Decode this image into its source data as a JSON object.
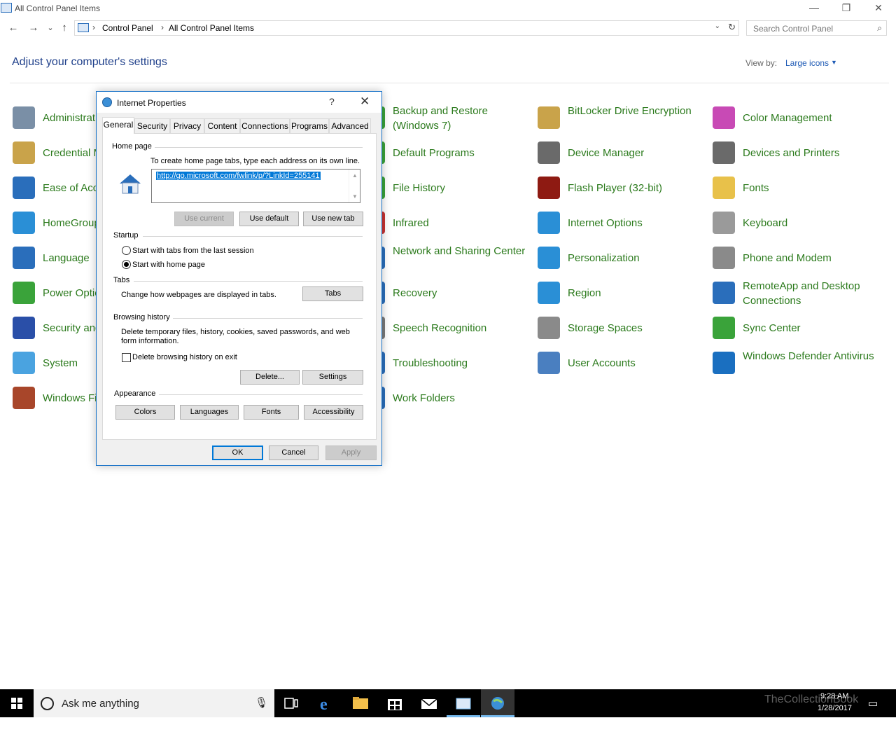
{
  "window": {
    "title": "All Control Panel Items",
    "controls": {
      "minimize": "—",
      "restore": "❐",
      "close": "✕"
    }
  },
  "nav": {
    "back": "←",
    "forward": "→",
    "recent": "⌄",
    "up": "↑",
    "breadcrumb": [
      "Control Panel",
      "All Control Panel Items"
    ],
    "search_placeholder": "Search Control Panel"
  },
  "header": {
    "title": "Adjust your computer's settings",
    "view_by_label": "View by:",
    "view_by_value": "Large icons"
  },
  "items": [
    {
      "label": "Administrative Tools",
      "icon": "admin-tools-icon",
      "color": "#7a8fa6"
    },
    {
      "label": "Credential Manager",
      "icon": "credential-icon",
      "color": "#c9a34a"
    },
    {
      "label": "Ease of Access Center",
      "icon": "ease-of-access-icon",
      "color": "#2a6ebb"
    },
    {
      "label": "HomeGroup",
      "icon": "homegroup-icon",
      "color": "#2a8fd6"
    },
    {
      "label": "Language",
      "icon": "language-icon",
      "color": "#2a6ebb"
    },
    {
      "label": "Power Options",
      "icon": "power-icon",
      "color": "#3aa33a"
    },
    {
      "label": "Security and Maintenance",
      "icon": "security-flag-icon",
      "color": "#2a4fa8"
    },
    {
      "label": "System",
      "icon": "system-icon",
      "color": "#4aa3e0"
    },
    {
      "label": "Windows Firewall",
      "icon": "firewall-icon",
      "color": "#a8462a"
    },
    {
      "label": "Backup and Restore (Windows 7)",
      "icon": "backup-icon",
      "color": "#3aa33a"
    },
    {
      "label": "Default Programs",
      "icon": "default-programs-icon",
      "color": "#3aa33a"
    },
    {
      "label": "File History",
      "icon": "file-history-icon",
      "color": "#3aa33a"
    },
    {
      "label": "Infrared",
      "icon": "infrared-icon",
      "color": "#c83232"
    },
    {
      "label": "Network and Sharing Center",
      "icon": "network-icon",
      "color": "#2a6ebb"
    },
    {
      "label": "Recovery",
      "icon": "recovery-icon",
      "color": "#2a6ebb"
    },
    {
      "label": "Speech Recognition",
      "icon": "speech-icon",
      "color": "#7a7a7a"
    },
    {
      "label": "Troubleshooting",
      "icon": "troubleshooting-icon",
      "color": "#2a6ebb"
    },
    {
      "label": "Work Folders",
      "icon": "work-folders-icon",
      "color": "#2a6ebb"
    },
    {
      "label": "BitLocker Drive Encryption",
      "icon": "bitlocker-icon",
      "color": "#c9a34a"
    },
    {
      "label": "Device Manager",
      "icon": "device-manager-icon",
      "color": "#6a6a6a"
    },
    {
      "label": "Flash Player (32-bit)",
      "icon": "flash-icon",
      "color": "#8e1a12"
    },
    {
      "label": "Internet Options",
      "icon": "internet-options-icon",
      "color": "#2a8fd6"
    },
    {
      "label": "Personalization",
      "icon": "personalization-icon",
      "color": "#2a8fd6"
    },
    {
      "label": "Region",
      "icon": "region-icon",
      "color": "#2a8fd6"
    },
    {
      "label": "Storage Spaces",
      "icon": "storage-spaces-icon",
      "color": "#8a8a8a"
    },
    {
      "label": "User Accounts",
      "icon": "user-accounts-icon",
      "color": "#4a7fc0"
    },
    {
      "label": "Color Management",
      "icon": "color-management-icon",
      "color": "#c84ab5"
    },
    {
      "label": "Devices and Printers",
      "icon": "devices-printers-icon",
      "color": "#6a6a6a"
    },
    {
      "label": "Fonts",
      "icon": "fonts-icon",
      "color": "#e8c14a"
    },
    {
      "label": "Keyboard",
      "icon": "keyboard-icon",
      "color": "#9a9a9a"
    },
    {
      "label": "Phone and Modem",
      "icon": "phone-modem-icon",
      "color": "#8a8a8a"
    },
    {
      "label": "RemoteApp and Desktop Connections",
      "icon": "remoteapp-icon",
      "color": "#2a6ebb"
    },
    {
      "label": "Sync Center",
      "icon": "sync-center-icon",
      "color": "#3aa33a"
    },
    {
      "label": "Windows Defender Antivirus",
      "icon": "defender-icon",
      "color": "#1a6fc0"
    }
  ],
  "dialog": {
    "title": "Internet Properties",
    "help": "?",
    "close": "✕",
    "tabs": [
      "General",
      "Security",
      "Privacy",
      "Content",
      "Connections",
      "Programs",
      "Advanced"
    ],
    "home_page": {
      "group": "Home page",
      "instruction": "To create home page tabs, type each address on its own line.",
      "url": "http://go.microsoft.com/fwlink/p/?LinkId=255141",
      "use_current": "Use current",
      "use_default": "Use default",
      "use_new_tab": "Use new tab"
    },
    "startup": {
      "group": "Startup",
      "option1": "Start with tabs from the last session",
      "option2": "Start with home page",
      "selected": "Start with home page"
    },
    "tabs_section": {
      "group": "Tabs",
      "text": "Change how webpages are displayed in tabs.",
      "button": "Tabs"
    },
    "browsing_history": {
      "group": "Browsing history",
      "text": "Delete temporary files, history, cookies, saved passwords, and web form information.",
      "checkbox": "Delete browsing history on exit",
      "checked": false,
      "delete": "Delete...",
      "settings": "Settings"
    },
    "appearance": {
      "group": "Appearance",
      "colors": "Colors",
      "languages": "Languages",
      "fonts": "Fonts",
      "accessibility": "Accessibility"
    },
    "ok": "OK",
    "cancel": "Cancel",
    "apply": "Apply"
  },
  "taskbar": {
    "search_placeholder": "Ask me anything",
    "time": "9:28 AM",
    "date": "1/28/2017",
    "watermark": "TheCollectionBook"
  }
}
